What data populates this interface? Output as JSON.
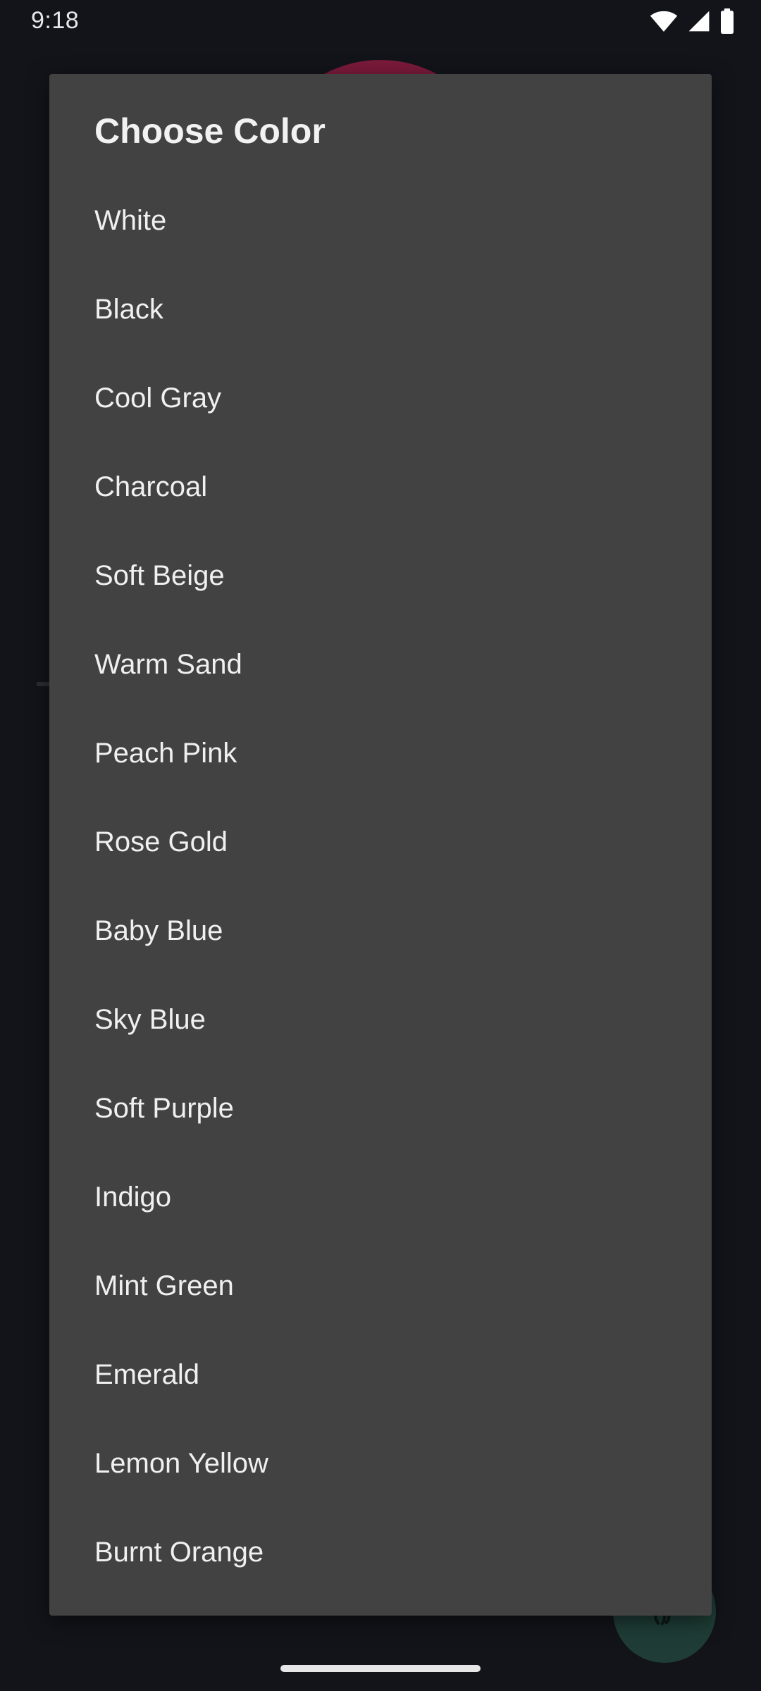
{
  "status_bar": {
    "time": "9:18",
    "icons": [
      "wifi-icon",
      "cellular-signal-icon",
      "battery-icon"
    ]
  },
  "dialog": {
    "title": "Choose Color",
    "options": [
      "White",
      "Black",
      "Cool Gray",
      "Charcoal",
      "Soft Beige",
      "Warm Sand",
      "Peach Pink",
      "Rose Gold",
      "Baby Blue",
      "Sky Blue",
      "Soft Purple",
      "Indigo",
      "Mint Green",
      "Emerald",
      "Lemon Yellow",
      "Burnt Orange"
    ]
  },
  "background": {
    "fab_icon": "fingerprint-icon"
  },
  "colors": {
    "dialog_bg": "#424242",
    "screen_bg": "#12141a",
    "text": "#f0f0f0",
    "ring_accent": "#7a1a3a",
    "fab_bg": "#1f3d36"
  }
}
